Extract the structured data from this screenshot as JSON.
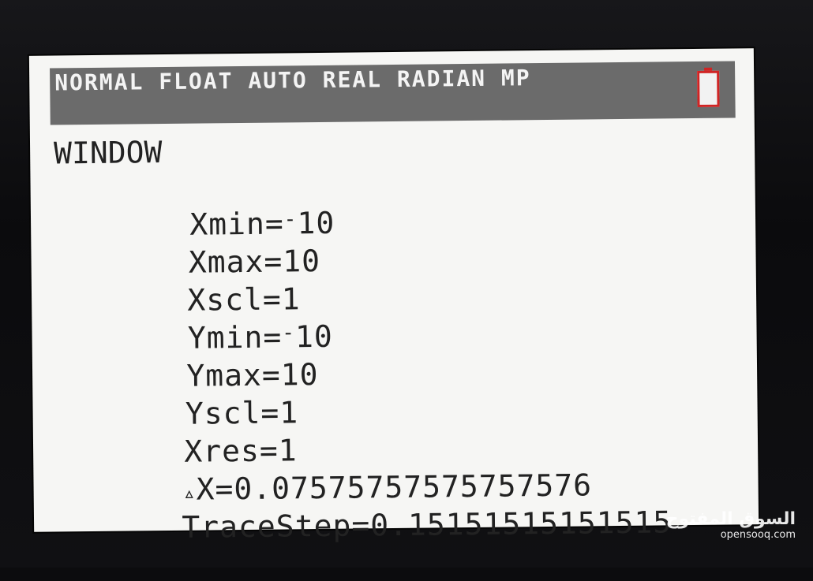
{
  "status_bar": {
    "text": "NORMAL FLOAT AUTO REAL RADIAN MP",
    "battery_icon": "battery-icon"
  },
  "screen": {
    "title": "WINDOW",
    "settings": [
      {
        "label": "Xmin=",
        "neg": "-",
        "value": "10"
      },
      {
        "label": "Xmax=",
        "neg": "",
        "value": "10"
      },
      {
        "label": "Xscl=",
        "neg": "",
        "value": "1"
      },
      {
        "label": "Ymin=",
        "neg": "-",
        "value": "10"
      },
      {
        "label": "Ymax=",
        "neg": "",
        "value": "10"
      },
      {
        "label": "Yscl=",
        "neg": "",
        "value": "1"
      },
      {
        "label": "Xres=",
        "neg": "",
        "value": "1"
      },
      {
        "symbol": "▵",
        "label": "X=",
        "neg": "",
        "value": "0.07575757575757576"
      },
      {
        "label": "TraceStep=",
        "neg": "",
        "value": "0.15151515151515"
      }
    ]
  },
  "watermark": {
    "arabic": "السوق المفتوح",
    "latin": "opensooq.com"
  },
  "colors": {
    "status_bar_bg": "#6b6b6b",
    "status_text": "#f4f4f4",
    "screen_bg": "#f6f6f4",
    "text": "#222222",
    "battery_border": "#d02424"
  }
}
